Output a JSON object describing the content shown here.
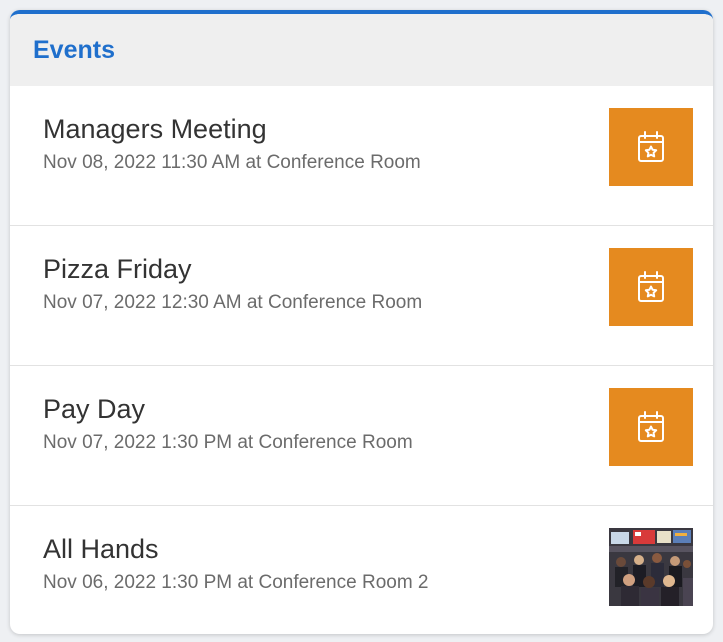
{
  "panel": {
    "title": "Events"
  },
  "events": [
    {
      "title": "Managers Meeting",
      "meta": "Nov 08, 2022 11:30 AM at Conference Room",
      "thumbnail": "calendar-star-icon",
      "thumb_color": "#e58a1f"
    },
    {
      "title": "Pizza Friday",
      "meta": "Nov 07, 2022 12:30 AM at Conference Room",
      "thumbnail": "calendar-star-icon",
      "thumb_color": "#e58a1f"
    },
    {
      "title": "Pay Day",
      "meta": "Nov 07, 2022 1:30 PM at Conference Room",
      "thumbnail": "calendar-star-icon",
      "thumb_color": "#e58a1f"
    },
    {
      "title": "All Hands",
      "meta": "Nov 06, 2022 1:30 PM at Conference Room 2",
      "thumbnail": "event-photo"
    }
  ],
  "colors": {
    "accent": "#1f6fcc",
    "thumb": "#e58a1f"
  }
}
